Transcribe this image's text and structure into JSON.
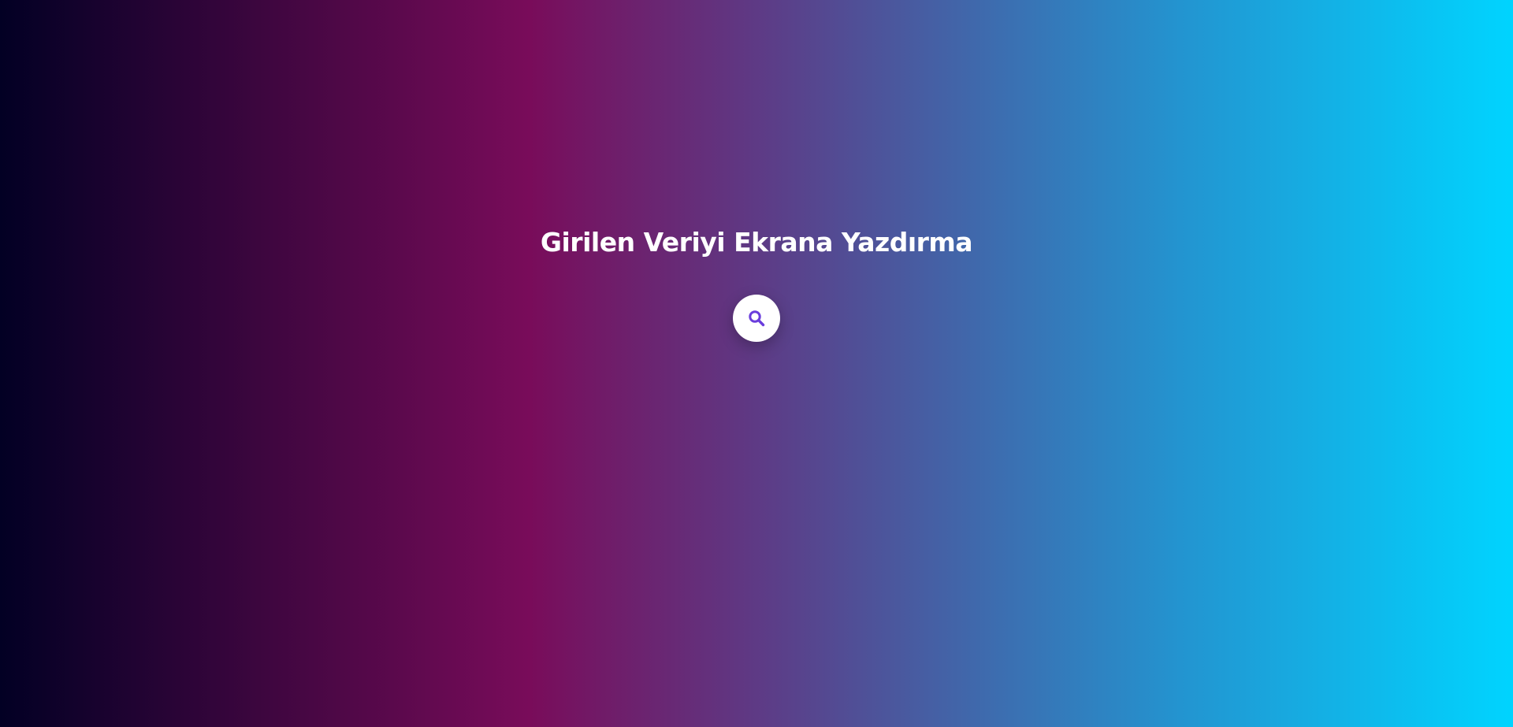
{
  "page": {
    "title": "Girilen Veriyi Ekrana Yazdırma"
  },
  "search_button": {
    "icon": "search-icon",
    "icon_color": "#6a3ddc",
    "background": "#ffffff"
  },
  "background_gradient": [
    "#020024",
    "#790c5a",
    "#5e3a85",
    "#2394d0",
    "#00d4ff"
  ]
}
